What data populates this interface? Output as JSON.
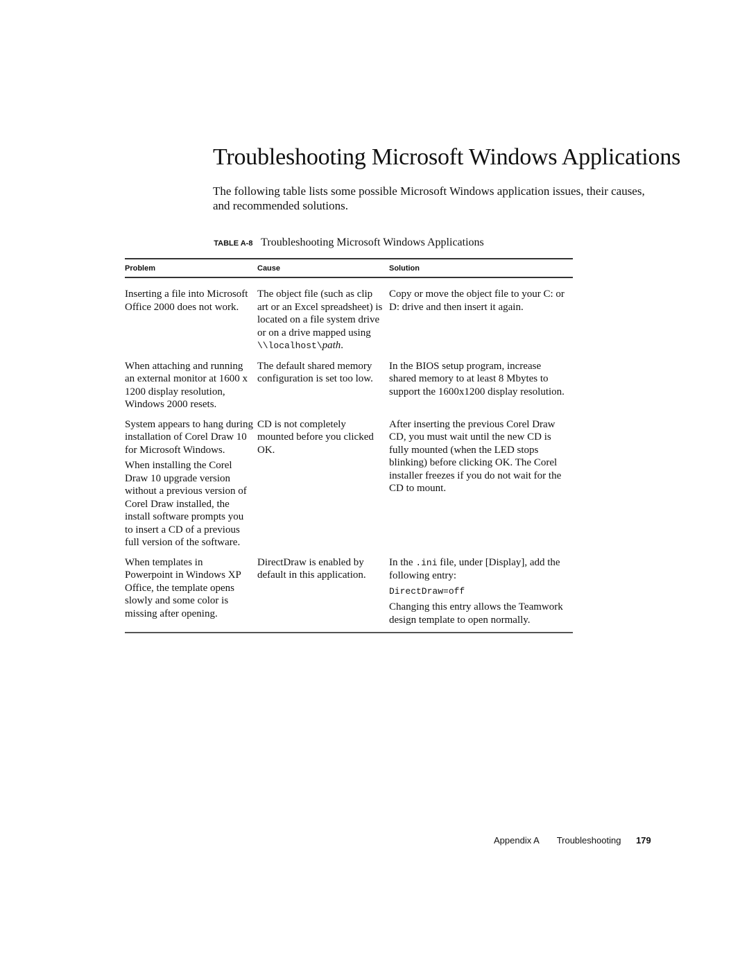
{
  "page": {
    "title": "Troubleshooting Microsoft Windows Applications",
    "intro": "The following table lists some possible Microsoft Windows application issues, their causes, and recommended solutions."
  },
  "table": {
    "caption_label": "TABLE A-8",
    "caption_text": "Troubleshooting Microsoft Windows Applications",
    "headers": [
      "Problem",
      "Cause",
      "Solution"
    ],
    "rows": [
      {
        "problem": [
          "Inserting a file into Microsoft Office 2000 does not work."
        ],
        "cause": {
          "text": "The object file (such as clip art or an Excel spreadsheet) is located on a file system drive or on a drive mapped using",
          "code": "\\\\localhost\\",
          "italic": "path",
          "end": "."
        },
        "solution": [
          "Copy or move the object file to your C: or D: drive and then insert it again."
        ]
      },
      {
        "problem": [
          "When attaching and running an external monitor at 1600 x 1200 display resolution, Windows 2000 resets."
        ],
        "cause": "The default shared memory configuration is set too low.",
        "solution": [
          "In the BIOS setup program, increase shared memory to at least 8 Mbytes to support the 1600x1200 display resolution."
        ]
      },
      {
        "problem": [
          "System appears to hang during installation of Corel Draw 10 for Microsoft Windows.",
          "When installing the Corel Draw 10 upgrade version without a previous version of Corel Draw installed, the install software prompts you to insert a CD of a previous full version of the software."
        ],
        "cause": "CD is not completely mounted before you clicked OK.",
        "solution": [
          "After inserting the previous Corel Draw CD, you must wait until the new CD is fully mounted (when the LED stops blinking) before clicking OK. The Corel installer freezes if you do not wait for the CD to mount."
        ]
      },
      {
        "problem": [
          "When templates in Powerpoint in Windows XP Office, the template opens slowly and some color is missing after opening."
        ],
        "cause": "DirectDraw is enabled by default in this application.",
        "solution": {
          "pre": "In the ",
          "code_inline": ".ini",
          "post": " file, under [Display], add the following entry:",
          "code_block": "DirectDraw=off",
          "after": "Changing this entry allows the Teamwork design template to open normally."
        }
      }
    ]
  },
  "footer": {
    "appendix": "Appendix A",
    "section": "Troubleshooting",
    "page_number": "179"
  }
}
